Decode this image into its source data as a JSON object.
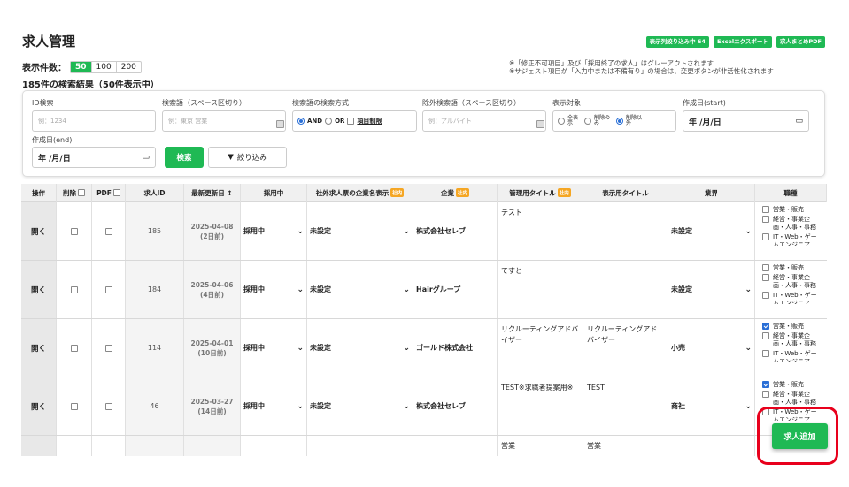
{
  "header": {
    "title": "求人管理",
    "buttons": [
      "表示列絞り込み中 64",
      "Excelエクスポート",
      "求人まとめPDF"
    ],
    "notes": [
      "※「修正不可項目」及び「採用終了の求人」はグレーアウトされます",
      "※サジェスト項目が「入力中または不備有り」の場合は、変更ボタンが非活性化されます"
    ]
  },
  "display": {
    "label": "表示件数：",
    "options": [
      "50",
      "100",
      "200"
    ],
    "selected": "50",
    "result": "185件の検索結果（50件表示中）"
  },
  "filters": {
    "id_label": "ID検索",
    "id_placeholder": "例：1234",
    "kw_label": "検索語（スペース区切り）",
    "kw_placeholder": "例：東京 営業",
    "mode_label": "検索語の検索方式",
    "mode_and": "AND",
    "mode_or": "OR",
    "mode_item": "項目制限",
    "ex_label": "除外検索語（スペース区切り）",
    "ex_placeholder": "例：アルバイト",
    "target_label": "表示対象",
    "target_all": "全表示",
    "target_only": "削除のみ",
    "target_except": "削除以外",
    "start_label": "作成日(start)",
    "start_value": "年 /月/日",
    "end_label": "作成日(end)",
    "end_value": "年 /月/日",
    "search_btn": "検索",
    "filter_btn": "絞り込み"
  },
  "table": {
    "headers": {
      "op": "操作",
      "del": "削除",
      "pdf": "PDF",
      "id": "求人ID",
      "updated": "最新更新日 ↕",
      "hiring": "採用中",
      "company_disp": "社外求人票の企業名表示",
      "company": "企業",
      "mgmt_title": "管理用タイトル",
      "disp_title": "表示用タイトル",
      "industry": "業界",
      "job": "職種",
      "tag": "社内"
    },
    "rows": [
      {
        "open": "開く",
        "id": "185",
        "date": "2025-04-08",
        "ago": "(2日前)",
        "hiring": "採用中",
        "cdisp": "未設定",
        "company": "株式会社セレブ",
        "mtitle": "テスト",
        "dtitle": "",
        "industry": "未設定",
        "j1": "営業・販売",
        "j2": "経営・事業企画・人事・事務",
        "j3": "IT・Web・ゲームエンジニア",
        "j1c": false
      },
      {
        "open": "開く",
        "id": "184",
        "date": "2025-04-06",
        "ago": "(4日前)",
        "hiring": "採用中",
        "cdisp": "未設定",
        "company": "Hairグループ",
        "mtitle": "てすと",
        "dtitle": "",
        "industry": "未設定",
        "j1": "営業・販売",
        "j2": "経営・事業企画・人事・事務",
        "j3": "IT・Web・ゲームエンジニア",
        "j1c": false
      },
      {
        "open": "開く",
        "id": "114",
        "date": "2025-04-01",
        "ago": "(10日前)",
        "hiring": "採用中",
        "cdisp": "未設定",
        "company": "ゴールド株式会社",
        "mtitle": "リクルーティングアドバイザー",
        "dtitle": "リクルーティングアドバイザー",
        "industry": "小売",
        "j1": "営業・販売",
        "j2": "経営・事業企画・人事・事務",
        "j3": "IT・Web・ゲームエンジニア",
        "j1c": true
      },
      {
        "open": "開く",
        "id": "46",
        "date": "2025-03-27",
        "ago": "(14日前)",
        "hiring": "採用中",
        "cdisp": "未設定",
        "company": "株式会社セレブ",
        "mtitle": "TEST※求職者提案用※",
        "dtitle": "TEST",
        "industry": "商社",
        "j1": "営業・販売",
        "j2": "経営・事業企画・人事・事務",
        "j3": "IT・Web・ゲームエンジニア",
        "j1c": true
      },
      {
        "mtitle": "営業",
        "dtitle": "営業"
      }
    ]
  },
  "add_button": "求人追加"
}
